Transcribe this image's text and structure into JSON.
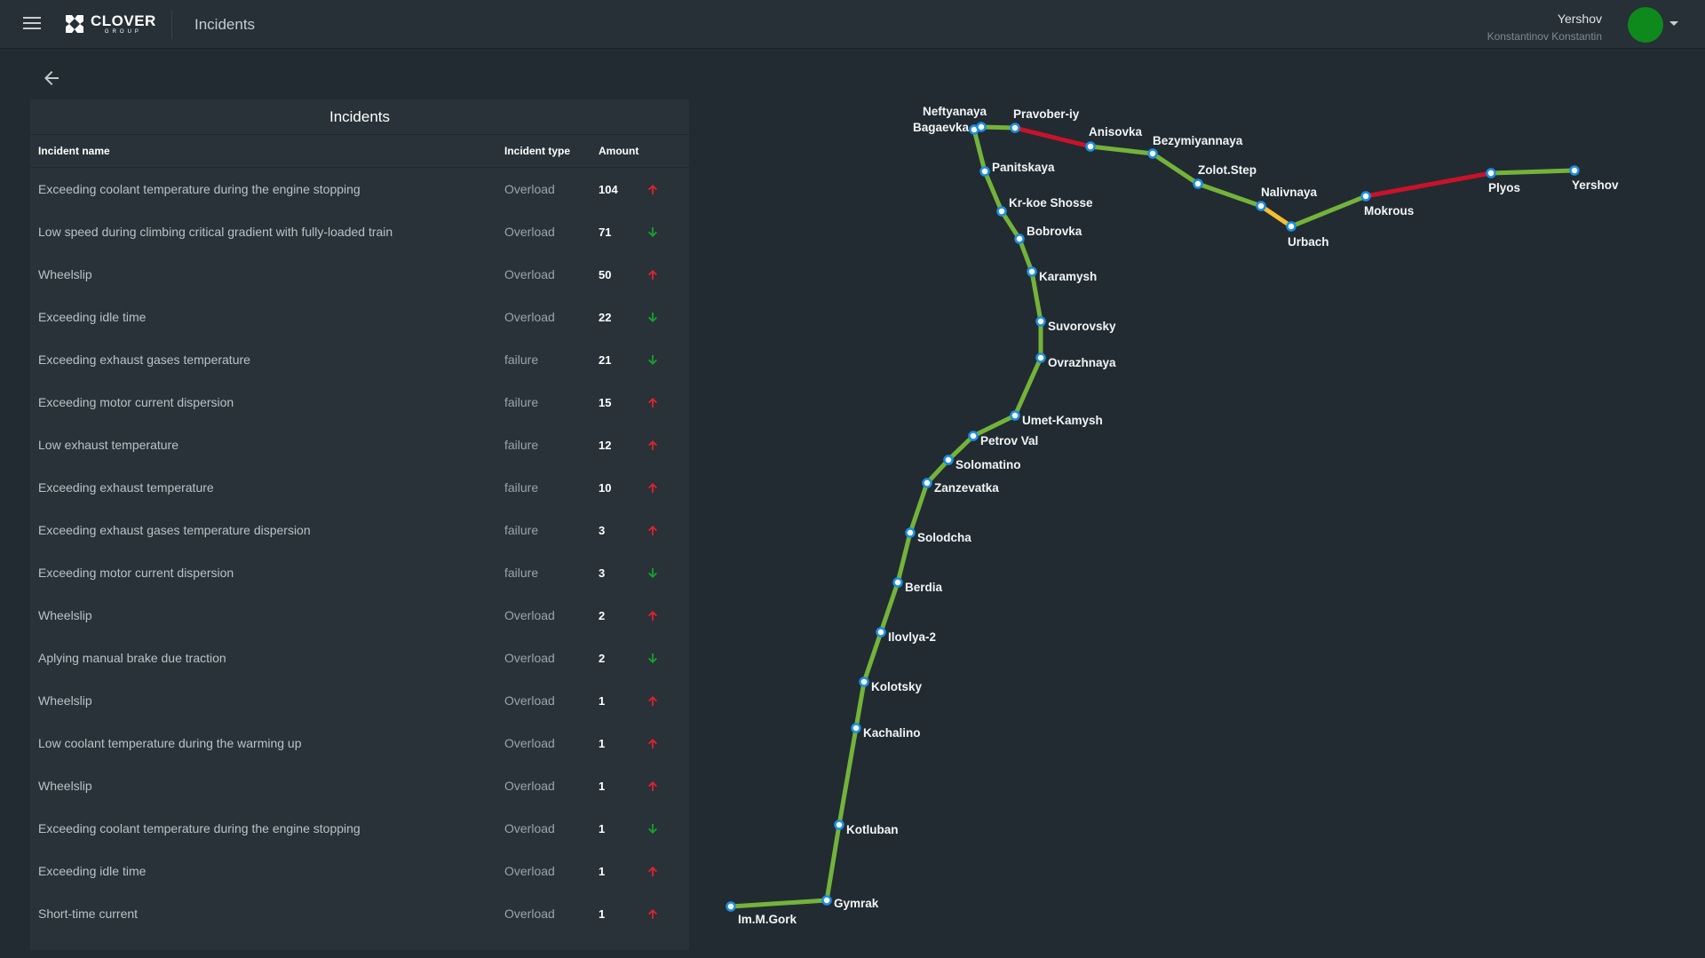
{
  "header": {
    "menu_icon": "hamburger-menu-icon",
    "logo_text": "CLOVER",
    "logo_subtext": "GROUP",
    "page_title": "Incidents",
    "user_name": "Yershov",
    "user_subtitle": "Konstantinov Konstantin",
    "avatar_color": "#0e8a1d"
  },
  "panel": {
    "title": "Incidents",
    "columns": {
      "name": "Incident name",
      "type": "Incident type",
      "amount": "Amount"
    },
    "rows": [
      {
        "name": "Exceeding coolant temperature during the engine stopping",
        "type": "Overload",
        "amount": "104",
        "trend": "up"
      },
      {
        "name": "Low speed during climbing critical gradient with fully-loaded train",
        "type": "Overload",
        "amount": "71",
        "trend": "down"
      },
      {
        "name": "Wheelslip",
        "type": "Overload",
        "amount": "50",
        "trend": "up"
      },
      {
        "name": "Exceeding idle time",
        "type": "Overload",
        "amount": "22",
        "trend": "down"
      },
      {
        "name": "Exceeding exhaust gases temperature",
        "type": "failure",
        "amount": "21",
        "trend": "down"
      },
      {
        "name": "Exceeding motor current dispersion",
        "type": "failure",
        "amount": "15",
        "trend": "up"
      },
      {
        "name": "Low exhaust temperature",
        "type": "failure",
        "amount": "12",
        "trend": "up"
      },
      {
        "name": "Exceeding exhaust temperature",
        "type": "failure",
        "amount": "10",
        "trend": "up"
      },
      {
        "name": "Exceeding exhaust gases temperature dispersion",
        "type": "failure",
        "amount": "3",
        "trend": "up"
      },
      {
        "name": "Exceeding motor current dispersion",
        "type": "failure",
        "amount": "3",
        "trend": "down"
      },
      {
        "name": "Wheelslip",
        "type": "Overload",
        "amount": "2",
        "trend": "up"
      },
      {
        "name": "Aplying manual brake due traction",
        "type": "Overload",
        "amount": "2",
        "trend": "down"
      },
      {
        "name": "Wheelslip",
        "type": "Overload",
        "amount": "1",
        "trend": "up"
      },
      {
        "name": "Low coolant temperature during the warming up",
        "type": "Overload",
        "amount": "1",
        "trend": "up"
      },
      {
        "name": "Wheelslip",
        "type": "Overload",
        "amount": "1",
        "trend": "up"
      },
      {
        "name": "Exceeding coolant temperature during the engine stopping",
        "type": "Overload",
        "amount": "1",
        "trend": "down"
      },
      {
        "name": "Exceeding idle time",
        "type": "Overload",
        "amount": "1",
        "trend": "up"
      },
      {
        "name": "Short-time current",
        "type": "Overload",
        "amount": "1",
        "trend": "up"
      }
    ]
  },
  "colors": {
    "trend_up": "#e0212f",
    "trend_down": "#17a12d",
    "route_ok": "#74b33b",
    "route_warning": "#f3be2f",
    "route_critical": "#c8122b",
    "station_fill": "#ffffff",
    "station_stroke": "#1b8fe0"
  },
  "map": {
    "stations": [
      "Im.M.Gork",
      "Gymrak",
      "Kotluban",
      "Kachalino",
      "Kolotsky",
      "Ilovlya-2",
      "Berdia",
      "Solodcha",
      "Zanzevatka",
      "Solomatino",
      "Petrov Val",
      "Umet-Kamysh",
      "Ovrazhnaya",
      "Suvorovsky",
      "Karamysh",
      "Bobrovka",
      "Kr-koe Shosse",
      "Panitskaya",
      "Bagaevka",
      "Neftyanaya",
      "Pravober-iy",
      "Anisovka",
      "Bezymiyannaya",
      "Zolot.Step",
      "Nalivnaya",
      "Urbach",
      "Mokrous",
      "Plyos",
      "Yershov"
    ],
    "segment_status": [
      "ok",
      "ok",
      "ok",
      "ok",
      "ok",
      "ok",
      "ok",
      "ok",
      "ok",
      "ok",
      "ok",
      "ok",
      "ok",
      "ok",
      "ok",
      "ok",
      "ok",
      "ok",
      "ok",
      "ok",
      "critical",
      "ok",
      "ok",
      "ok",
      "warning",
      "ok",
      "critical"
    ]
  }
}
